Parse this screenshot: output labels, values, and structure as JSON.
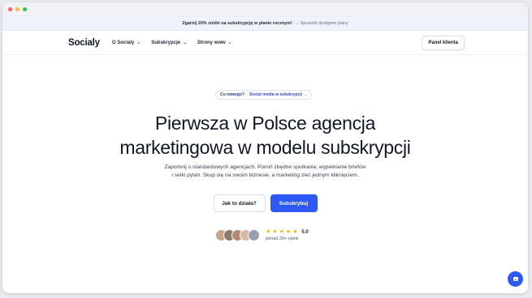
{
  "promo": {
    "text": "Zgarnij 20% zniżki na subskrypcję w planie rocznym!",
    "link": "→ Sprawdź dostępne plany"
  },
  "nav": {
    "logo": "Socialy",
    "items": [
      {
        "label": "O Socialy"
      },
      {
        "label": "Subskrypcje"
      },
      {
        "label": "Strony www"
      }
    ],
    "panel_button": "Panel klienta"
  },
  "hero": {
    "pill_new": "Co nowego?",
    "pill_topic": "Social media w subskrypcji →",
    "title_line1": "Pierwsza w Polsce agencja",
    "title_line2": "marketingowa w modelu subskrypcji",
    "lead_line1": "Zapomnij o standardowych agencjach. Pomiń zbędne spotkania, wypełnianie briefów",
    "lead_line2": "i setki pytań. Skup się na swoim biznesie, a marketing zleć jednym kliknięciem.",
    "cta_secondary": "Jak to działa?",
    "cta_primary": "Subskrybuj"
  },
  "social_proof": {
    "rating": "5.0",
    "reviews": "ponad 20+ opinii",
    "avatar_colors": [
      "#c9a38a",
      "#8a7a6e",
      "#b58a74",
      "#d7b8a3",
      "#9aa0b4"
    ]
  },
  "colors": {
    "accent": "#2c59f5",
    "star": "#f5b400"
  }
}
